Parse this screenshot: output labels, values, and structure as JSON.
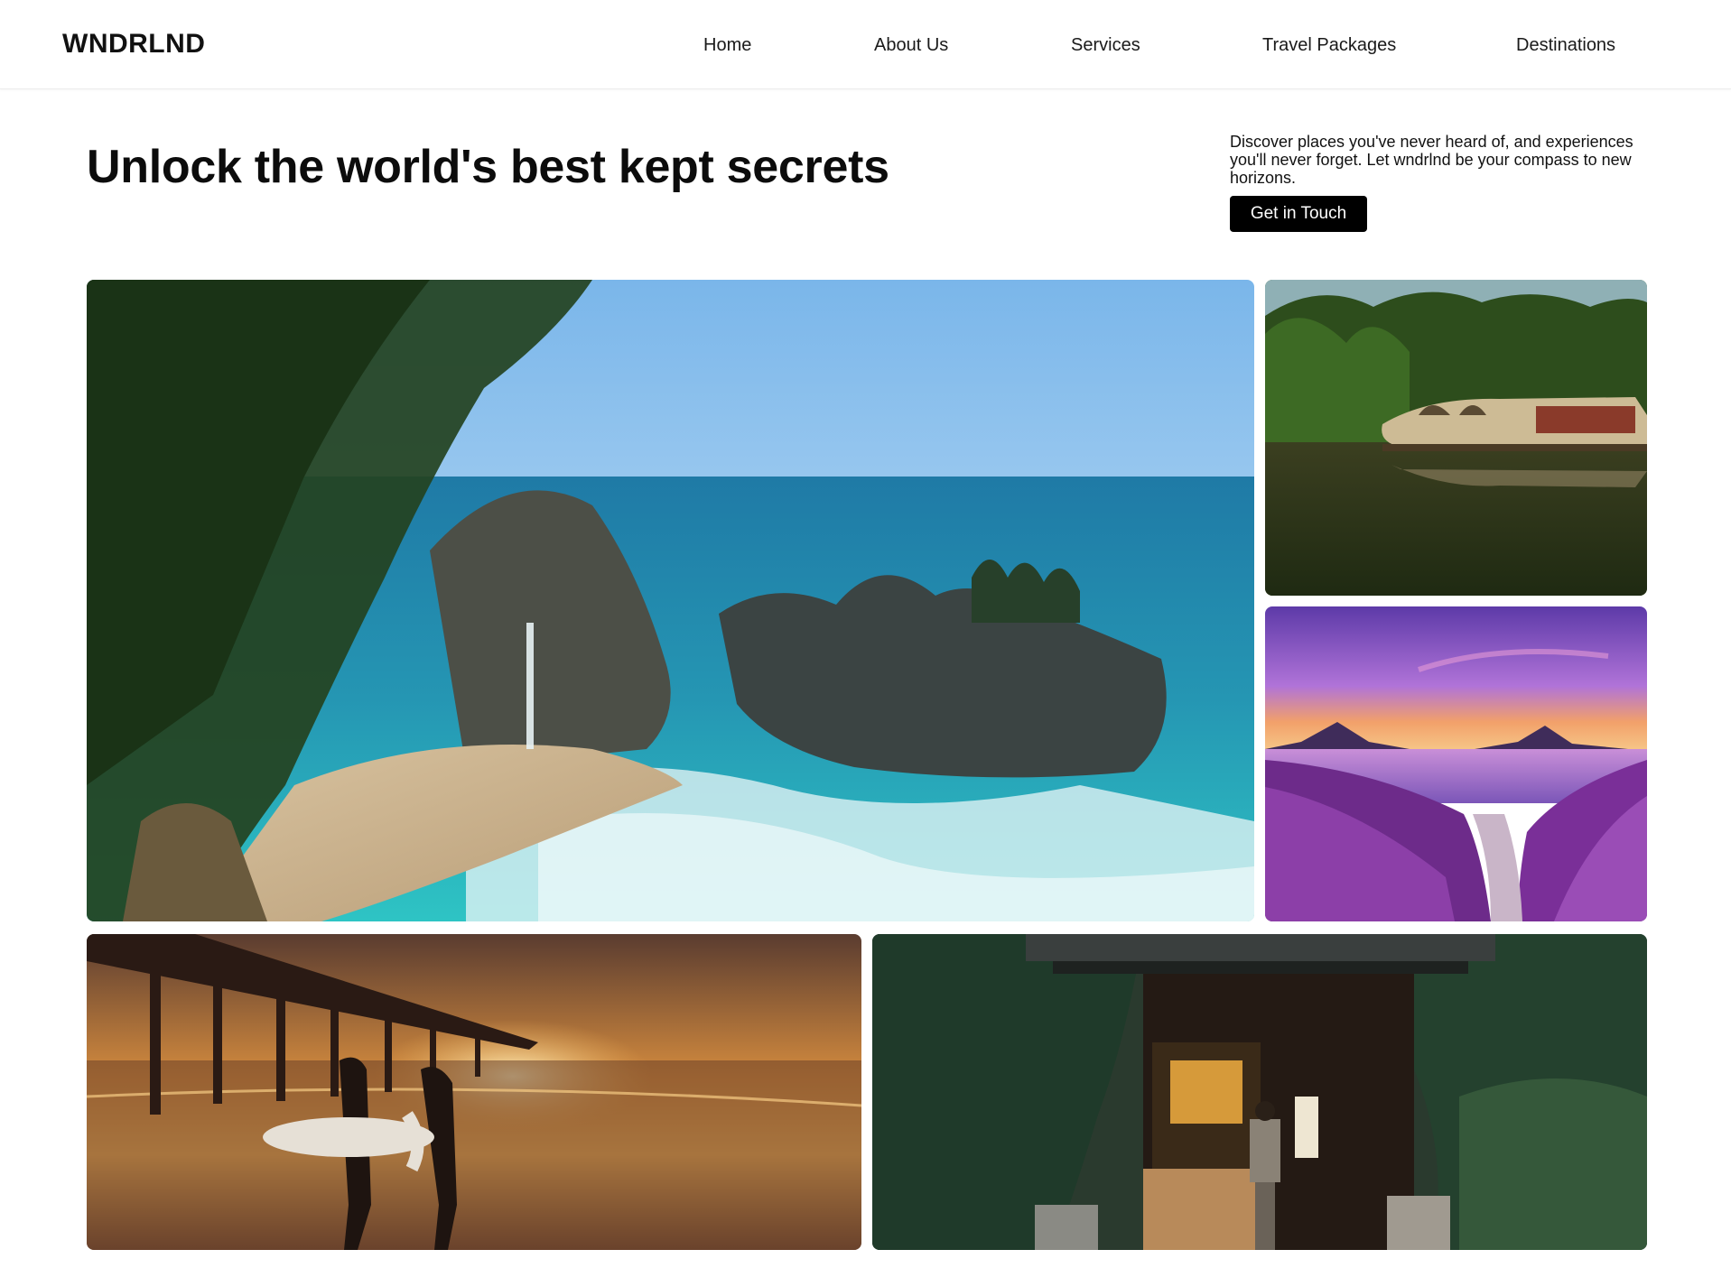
{
  "brand": {
    "logo_text": "WNDRLND"
  },
  "nav": {
    "items": [
      {
        "label": "Home"
      },
      {
        "label": "About Us"
      },
      {
        "label": "Services"
      },
      {
        "label": "Travel Packages"
      },
      {
        "label": "Destinations"
      }
    ]
  },
  "hero": {
    "headline": "Unlock the world's best kept secrets",
    "tagline": "Discover places you've never heard of, and experiences you'll never forget. Let wndrlnd be your compass to new horizons.",
    "cta_label": "Get in Touch"
  },
  "gallery": {
    "images": [
      {
        "icon": "coastal-waterfall-photo"
      },
      {
        "icon": "houseboat-backwaters-photo"
      },
      {
        "icon": "lavender-lake-sunset-photo"
      },
      {
        "icon": "surfers-pier-sunset-photo"
      },
      {
        "icon": "japanese-shrine-gate-photo"
      }
    ]
  },
  "colors": {
    "text": "#0b0b0b",
    "button_bg": "#000000",
    "button_text": "#ffffff",
    "background": "#ffffff"
  }
}
